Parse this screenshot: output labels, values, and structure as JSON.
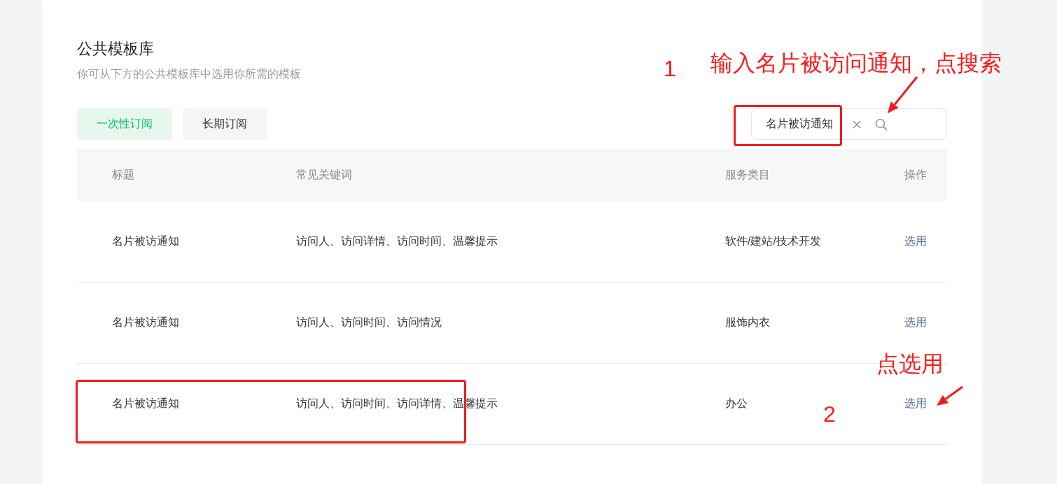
{
  "page": {
    "title": "公共模板库",
    "subtitle": "你可从下方的公共模板库中选用你所需的模板"
  },
  "tabs": [
    {
      "label": "一次性订阅",
      "selected": true
    },
    {
      "label": "长期订阅",
      "selected": false
    }
  ],
  "search": {
    "value": "名片被访通知"
  },
  "table": {
    "columns": [
      "标题",
      "常见关键词",
      "服务类目",
      "操作"
    ],
    "rows": [
      {
        "title": "名片被访通知",
        "keywords": "访问人、访问详情、访问时间、温馨提示",
        "category": "软件/建站/技术开发",
        "action": "选用"
      },
      {
        "title": "名片被访通知",
        "keywords": "访问人、访问时间、访问情况",
        "category": "服饰内衣",
        "action": "选用"
      },
      {
        "title": "名片被访通知",
        "keywords": "访问人、访问时间、访问详情、温馨提示",
        "category": "办公",
        "action": "选用"
      }
    ]
  },
  "annotations": [
    {
      "kind": "step",
      "text": "1"
    },
    {
      "kind": "note",
      "text": "输入名片被访问通知，点搜索"
    },
    {
      "kind": "box"
    },
    {
      "kind": "arrow"
    },
    {
      "kind": "note",
      "text": "点选用"
    },
    {
      "kind": "step",
      "text": "2"
    },
    {
      "kind": "arrow"
    },
    {
      "kind": "box"
    }
  ]
}
